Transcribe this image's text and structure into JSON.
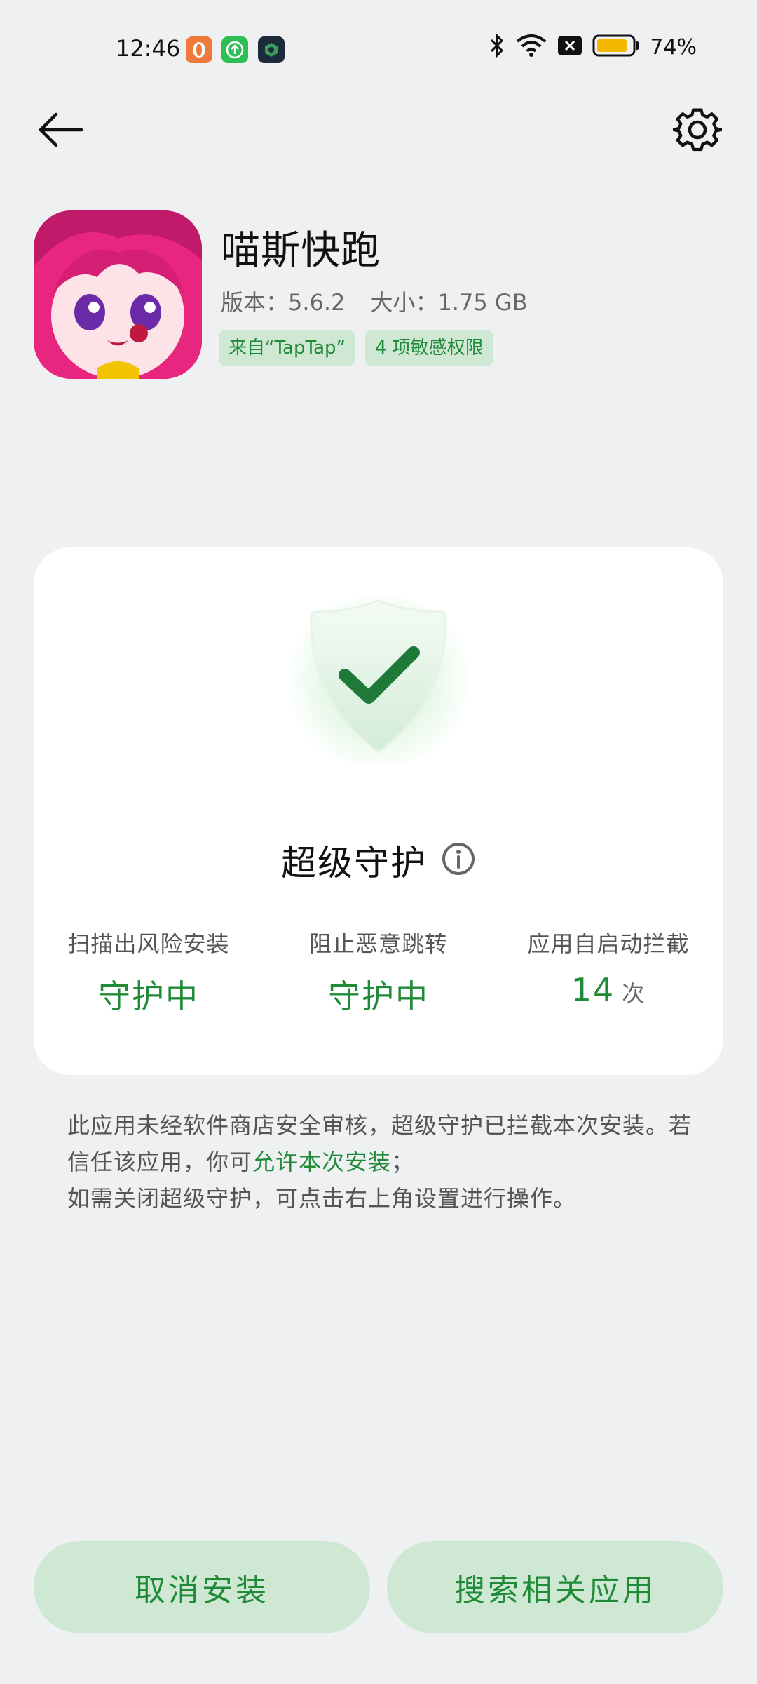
{
  "status_bar": {
    "time": "12:46",
    "battery": "74%"
  },
  "app": {
    "name": "喵斯快跑",
    "version": "版本：5.6.2",
    "size": "大小：1.75 GB",
    "tags": [
      "来自“TapTap”",
      "4 项敏感权限"
    ]
  },
  "card": {
    "title": "超级守护",
    "stats": [
      {
        "label": "扫描出风险安装",
        "value": "守护中"
      },
      {
        "label": "阻止恶意跳转",
        "value": "守护中"
      },
      {
        "label": "应用自启动拦截",
        "value": "14",
        "unit": "次"
      }
    ]
  },
  "description": {
    "part1": "此应用未经软件商店安全审核，超级守护已拦截本次安装。若信任该应用，你可",
    "link": "允许本次安装",
    "part2": "；",
    "line2": "如需关闭超级守护，可点击右上角设置进行操作。"
  },
  "buttons": {
    "cancel": "取消安装",
    "search": "搜索相关应用"
  },
  "colors": {
    "accent": "#1f8a37",
    "tag_bg": "#cfe8d3",
    "page_bg": "#eff0f2"
  },
  "icons": {
    "back": "arrow-left-icon",
    "settings": "gear-icon",
    "shield": "shield-check-icon",
    "info": "info-circle-icon"
  }
}
